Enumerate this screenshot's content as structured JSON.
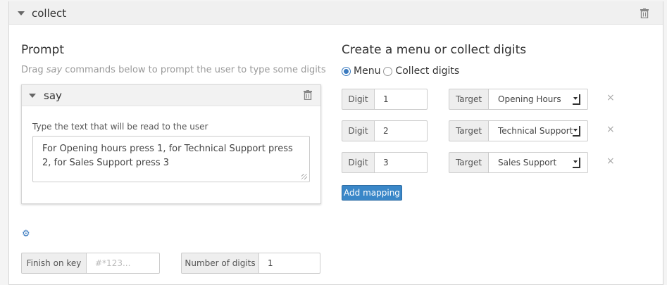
{
  "section": {
    "title": "collect"
  },
  "prompt": {
    "heading": "Prompt",
    "help_before": "Drag ",
    "help_em": "say",
    "help_after": " commands below to prompt the user to type some digits",
    "say_card": {
      "title": "say",
      "label": "Type the text that will be read to the user",
      "text": "For Opening hours press 1, for Technical Support press 2, for Sales Support press 3"
    }
  },
  "menu": {
    "heading": "Create a menu or collect digits",
    "options": [
      {
        "label": "Menu",
        "checked": true
      },
      {
        "label": "Collect digits",
        "checked": false
      }
    ],
    "digit_label": "Digit",
    "target_label": "Target",
    "mappings": [
      {
        "digit": "1",
        "target": "Opening Hours"
      },
      {
        "digit": "2",
        "target": "Technical Support"
      },
      {
        "digit": "3",
        "target": "Sales Support"
      }
    ],
    "remove_glyph": "×",
    "add_mapping_label": "Add mapping"
  },
  "footer": {
    "finish_on_key_label": "Finish on key",
    "finish_on_key_placeholder": "#*123...",
    "number_of_digits_label": "Number of digits",
    "number_of_digits_value": "1"
  },
  "icons": {
    "section_toggle": "caret-down-icon",
    "section_delete": "trash-icon",
    "say_toggle": "caret-down-icon",
    "say_delete": "trash-icon",
    "settings": "gear-icon"
  },
  "colors": {
    "accent": "#3a87c8",
    "header_bg": "#f0f0f0"
  }
}
